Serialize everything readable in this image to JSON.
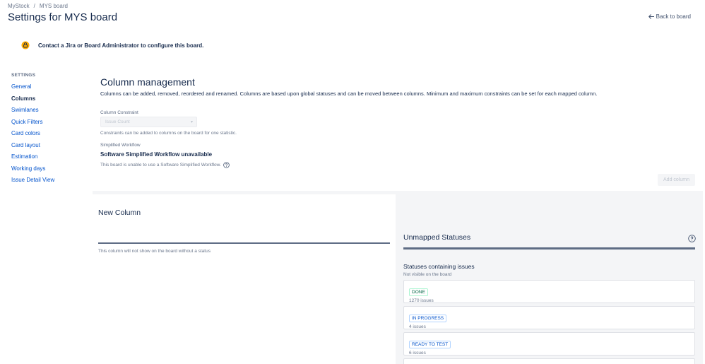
{
  "breadcrumb": {
    "project": "MyStock",
    "separator": "/",
    "board": "MYS board"
  },
  "page": {
    "title": "Settings for MYS board",
    "back_link": "Back to board"
  },
  "warning": {
    "text": "Contact a Jira or Board Administrator to configure this board."
  },
  "sidebar": {
    "heading": "SETTINGS",
    "items": [
      {
        "label": "General"
      },
      {
        "label": "Columns"
      },
      {
        "label": "Swimlanes"
      },
      {
        "label": "Quick Filters"
      },
      {
        "label": "Card colors"
      },
      {
        "label": "Card layout"
      },
      {
        "label": "Estimation"
      },
      {
        "label": "Working days"
      },
      {
        "label": "Issue Detail View"
      }
    ]
  },
  "main": {
    "title": "Column management",
    "description": "Columns can be added, removed, reordered and renamed. Columns are based upon global statuses and can be moved between columns. Minimum and maximum constraints can be set for each mapped column.",
    "constraint": {
      "label": "Column Constraint",
      "value": "Issue Count",
      "help": "Constraints can be added to columns on the board for one statistic."
    },
    "workflow": {
      "label": "Simplified Workflow",
      "title": "Software Simplified Workflow unavailable",
      "help": "This board is unable to use a Software Simplified Workflow."
    },
    "add_column": "Add column"
  },
  "new_column": {
    "title": "New Column",
    "hint": "This column will not show on the board without a status"
  },
  "unmapped": {
    "title": "Unmapped Statuses",
    "heading": "Statuses containing issues",
    "subheading": "Not visible on the board",
    "statuses": [
      {
        "name": "DONE",
        "issues": "1270 issues",
        "color": "#006644",
        "border": "#abf5d1"
      },
      {
        "name": "IN PROGRESS",
        "issues": "4 issues",
        "color": "#0052cc",
        "border": "#b3d4ff"
      },
      {
        "name": "READY TO TEST",
        "issues": "6 issues",
        "color": "#0052cc",
        "border": "#b3d4ff"
      }
    ]
  }
}
